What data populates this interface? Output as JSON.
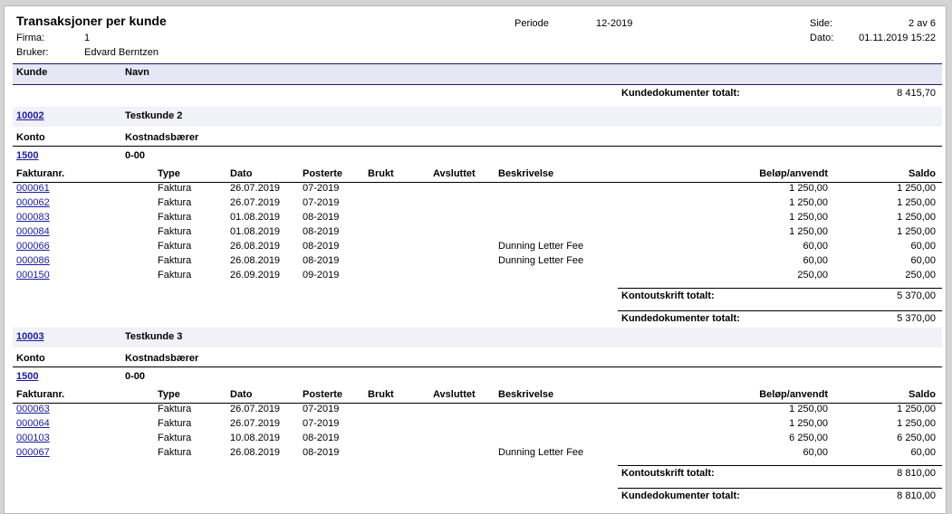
{
  "header": {
    "title": "Transaksjoner per kunde",
    "firma_label": "Firma:",
    "firma_value": "1",
    "bruker_label": "Bruker:",
    "bruker_value": "Edvard Berntzen",
    "periode_label": "Periode",
    "periode_value": "12-2019",
    "side_label": "Side:",
    "side_value": "2 av 6",
    "dato_label": "Dato:",
    "dato_value": "01.11.2019 15:22"
  },
  "columns": {
    "kunde": "Kunde",
    "navn": "Navn"
  },
  "top_total": {
    "label": "Kundedokumenter totalt:",
    "value": "8 415,70"
  },
  "labels": {
    "konto": "Konto",
    "kostnadsbaerer": "Kostnadsbærer",
    "fakturanr": "Fakturanr.",
    "type": "Type",
    "dato": "Dato",
    "posterte": "Posterte",
    "brukt": "Brukt",
    "avsluttet": "Avsluttet",
    "beskrivelse": "Beskrivelse",
    "belop": "Beløp/anvendt",
    "saldo": "Saldo",
    "kontoutskrift_totalt": "Kontoutskrift totalt:",
    "kundedokumenter_totalt": "Kundedokumenter totalt:"
  },
  "customers": [
    {
      "id": "10002",
      "name": "Testkunde 2",
      "konto": "1500",
      "kostnadsbaerer": "0-00",
      "rows": [
        {
          "nr": "000061",
          "type": "Faktura",
          "dato": "26.07.2019",
          "posterte": "07-2019",
          "beskrivelse": "",
          "belop": "1 250,00",
          "saldo": "1 250,00"
        },
        {
          "nr": "000062",
          "type": "Faktura",
          "dato": "26.07.2019",
          "posterte": "07-2019",
          "beskrivelse": "",
          "belop": "1 250,00",
          "saldo": "1 250,00"
        },
        {
          "nr": "000083",
          "type": "Faktura",
          "dato": "01.08.2019",
          "posterte": "08-2019",
          "beskrivelse": "",
          "belop": "1 250,00",
          "saldo": "1 250,00"
        },
        {
          "nr": "000084",
          "type": "Faktura",
          "dato": "01.08.2019",
          "posterte": "08-2019",
          "beskrivelse": "",
          "belop": "1 250,00",
          "saldo": "1 250,00"
        },
        {
          "nr": "000066",
          "type": "Faktura",
          "dato": "26.08.2019",
          "posterte": "08-2019",
          "beskrivelse": "Dunning Letter Fee",
          "belop": "60,00",
          "saldo": "60,00"
        },
        {
          "nr": "000086",
          "type": "Faktura",
          "dato": "26.08.2019",
          "posterte": "08-2019",
          "beskrivelse": "Dunning Letter Fee",
          "belop": "60,00",
          "saldo": "60,00"
        },
        {
          "nr": "000150",
          "type": "Faktura",
          "dato": "26.09.2019",
          "posterte": "09-2019",
          "beskrivelse": "",
          "belop": "250,00",
          "saldo": "250,00"
        }
      ],
      "kontoutskrift_total": "5 370,00",
      "kundedokumenter_total": "5 370,00"
    },
    {
      "id": "10003",
      "name": "Testkunde 3",
      "konto": "1500",
      "kostnadsbaerer": "0-00",
      "rows": [
        {
          "nr": "000063",
          "type": "Faktura",
          "dato": "26.07.2019",
          "posterte": "07-2019",
          "beskrivelse": "",
          "belop": "1 250,00",
          "saldo": "1 250,00"
        },
        {
          "nr": "000064",
          "type": "Faktura",
          "dato": "26.07.2019",
          "posterte": "07-2019",
          "beskrivelse": "",
          "belop": "1 250,00",
          "saldo": "1 250,00"
        },
        {
          "nr": "000103",
          "type": "Faktura",
          "dato": "10.08.2019",
          "posterte": "08-2019",
          "beskrivelse": "",
          "belop": "6 250,00",
          "saldo": "6 250,00"
        },
        {
          "nr": "000067",
          "type": "Faktura",
          "dato": "26.08.2019",
          "posterte": "08-2019",
          "beskrivelse": "Dunning Letter Fee",
          "belop": "60,00",
          "saldo": "60,00"
        }
      ],
      "kontoutskrift_total": "8 810,00",
      "kundedokumenter_total": "8 810,00"
    }
  ]
}
